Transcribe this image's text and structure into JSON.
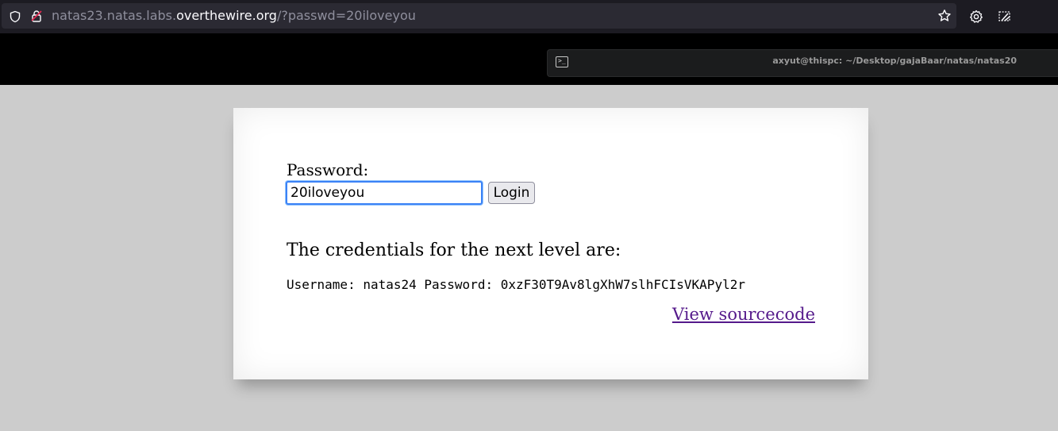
{
  "browser": {
    "url_prefix": "natas23.natas.labs.",
    "url_domain": "overthewire.org",
    "url_suffix": "/?passwd=20iloveyou"
  },
  "taskbar": {
    "window_title": "axyut@thispc: ~/Desktop/gajaBaar/natas/natas20",
    "terminal_glyph": ">_"
  },
  "page": {
    "password_label": "Password:",
    "password_value": "20iloveyou",
    "login_label": "Login",
    "credentials_heading": "The credentials for the next level are:",
    "credentials_line": "Username: natas24 Password: 0xzF30T9Av8lgXhW7slhFCIsVKAPyl2r",
    "view_source_label": "View sourcecode"
  },
  "colors": {
    "page_background": "#cccccc",
    "link_visited": "#551a8b",
    "input_focus": "#3b82f6"
  }
}
